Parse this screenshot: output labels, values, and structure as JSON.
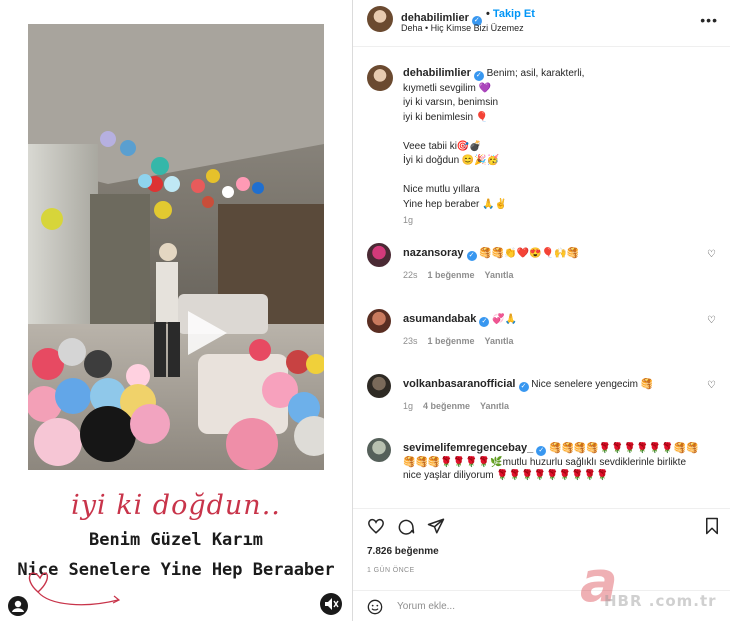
{
  "post": {
    "image_text": {
      "line1": "iyi ki doğdun..",
      "line2": "Benim Güzel Karım",
      "line3": "Nice Senelere Yine Hep Beraaber"
    }
  },
  "header": {
    "username": "dehabilimlier",
    "separator": "•",
    "follow_label": "Takip Et",
    "subtitle": "Deha • Hiç Kimse Bizi Üzemez",
    "more_label": "•••"
  },
  "caption": {
    "username": "dehabilimlier",
    "first_line": "Benim; asil, karakterli,",
    "lines": [
      "kıymetli sevgilim 💜",
      "iyi ki varsın, benimsin",
      "iyi ki benimlesin 🎈",
      "Veee tabii ki🎯💣",
      "İyi ki doğdun 😊🎉🥳",
      "Nice mutlu yıllara",
      "Yine hep beraber 🙏✌"
    ],
    "time": "1g"
  },
  "comments": [
    {
      "username": "nazansoray",
      "text": "🥞🥞👏❤️😍🎈🙌🥞",
      "time": "22s",
      "likes": "1 beğenme",
      "reply": "Yanıtla"
    },
    {
      "username": "asumandabak",
      "text": "💞🙏",
      "time": "23s",
      "likes": "1 beğenme",
      "reply": "Yanıtla"
    },
    {
      "username": "volkanbasaranofficial",
      "text": "Nice senelere yengecim 🥞",
      "time": "1g",
      "likes": "4 beğenme",
      "reply": "Yanıtla"
    },
    {
      "username": "sevimelifemregencebay_",
      "text": "🥞🥞🥞🥞🌹🌹🌹🌹🌹🌹🥞🥞🥞🥞🥞🌹🌹🌹🌹🌿mutlu huzurlu sağlıklı sevdiklerinle birlikte nice yaşlar diliyorum 🌹🌹🌹🌹🌹🌹🌹🌹🌹"
    }
  ],
  "likes_count": "7.826 beğenme",
  "post_date": "1 GÜN ÖNCE",
  "comment_placeholder": "Yorum ekle...",
  "watermark": {
    "letter": "a",
    "text": "HBR .com.tr"
  },
  "colors": {
    "link_blue": "#0095f6",
    "verified_blue": "#3897f0",
    "script_red": "#c8344a"
  },
  "icons": [
    "heart-icon",
    "comment-icon",
    "share-icon",
    "bookmark-icon",
    "play-icon",
    "mute-icon",
    "user-tag-icon",
    "smiley-icon"
  ]
}
